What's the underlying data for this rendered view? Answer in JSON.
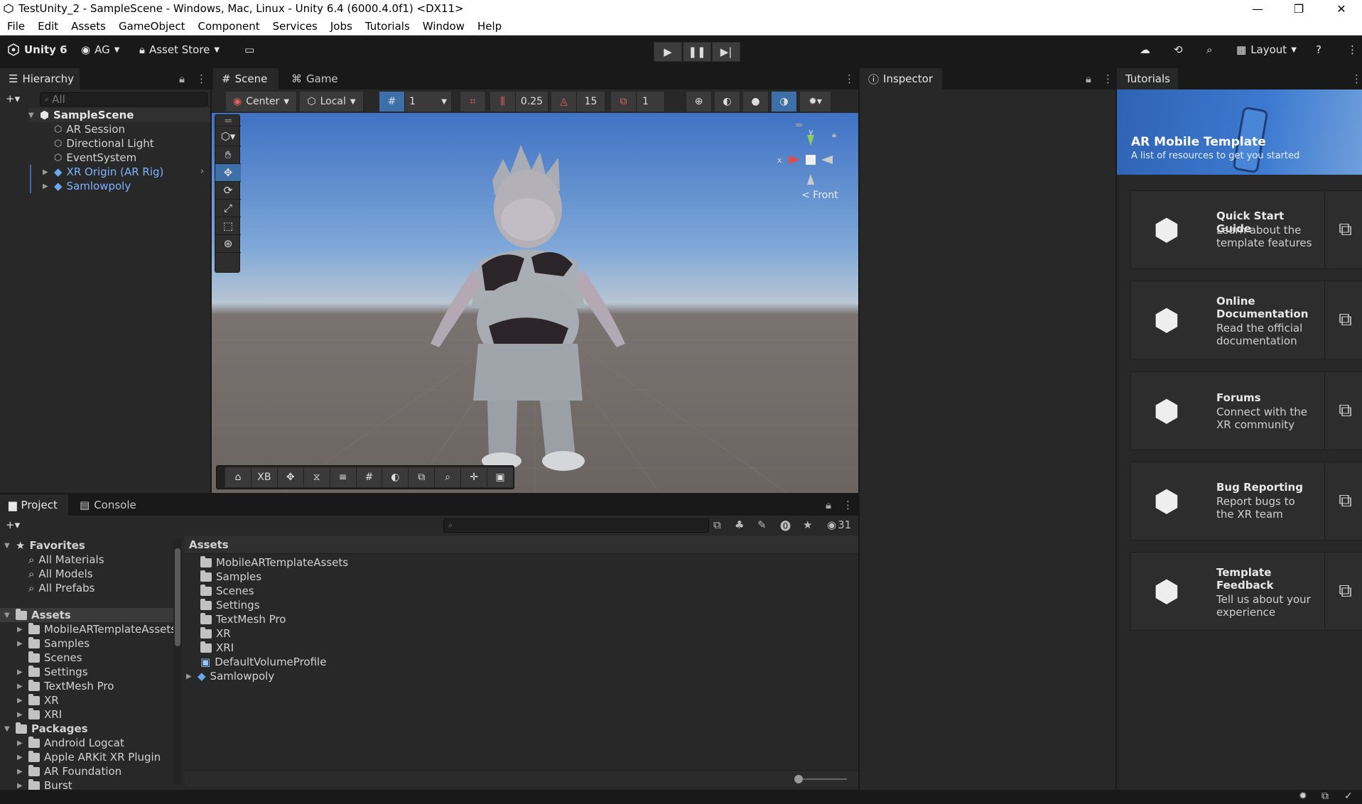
{
  "window": {
    "title": "TestUnity_2 - SampleScene - Windows, Mac, Linux - Unity 6.4 (6000.4.0f1) <DX11>",
    "minimize": "—",
    "maximize": "❐",
    "close": "✕"
  },
  "menu": [
    "File",
    "Edit",
    "Assets",
    "GameObject",
    "Component",
    "Services",
    "Jobs",
    "Tutorials",
    "Window",
    "Help"
  ],
  "toolbar": {
    "unity_label": "Unity 6",
    "account_label": "AG",
    "asset_store_label": "Asset Store",
    "layout_label": "Layout"
  },
  "hierarchy": {
    "tab": "Hierarchy",
    "search_placeholder": "All",
    "scene": "SampleScene",
    "items": [
      "AR Session",
      "Directional Light",
      "EventSystem",
      "XR Origin (AR Rig)",
      "Samlowpoly"
    ]
  },
  "scene_view": {
    "tab_scene": "Scene",
    "tab_game": "Game",
    "pivot_mode": "Center",
    "pivot_rotation": "Local",
    "grid_value": "1",
    "snap_increment": "0.25",
    "rotate_snap": "15",
    "scale_snap": "1",
    "gizmo_label": "< Front",
    "gizmo_y": "y",
    "gizmo_x": "x",
    "bottom_toolbar_label": "XB"
  },
  "inspector": {
    "tab": "Inspector"
  },
  "tutorials": {
    "tab": "Tutorials",
    "banner_title": "AR Mobile Template",
    "banner_subtitle": "A list of resources to get you started",
    "cards": [
      {
        "title": "Quick Start Guide",
        "desc": "Learn about the template features"
      },
      {
        "title": "Online Documentation",
        "desc": "Read the official documentation"
      },
      {
        "title": "Forums",
        "desc": "Connect with the XR community"
      },
      {
        "title": "Bug Reporting",
        "desc": "Report bugs to the XR team"
      },
      {
        "title": "Template Feedback",
        "desc": "Tell us about your experience"
      }
    ]
  },
  "project": {
    "tab_project": "Project",
    "tab_console": "Console",
    "hidden_count": "31",
    "favorites_label": "Favorites",
    "favorites": [
      "All Materials",
      "All Models",
      "All Prefabs"
    ],
    "assets_label": "Assets",
    "tree_assets": [
      "MobileARTemplateAssets",
      "Samples",
      "Scenes",
      "Settings",
      "TextMesh Pro",
      "XR",
      "XRI"
    ],
    "packages_label": "Packages",
    "tree_packages": [
      "Android Logcat",
      "Apple ARKit XR Plugin",
      "AR Foundation",
      "Burst"
    ],
    "breadcrumb": "Assets",
    "grid_items": [
      "MobileARTemplateAssets",
      "Samples",
      "Scenes",
      "Settings",
      "TextMesh Pro",
      "XR",
      "XRI",
      "DefaultVolumeProfile",
      "Samlowpoly"
    ]
  },
  "colors": {
    "accent": "#3d6fa8",
    "selected_text": "#7fb2ff",
    "background": "#282828"
  }
}
